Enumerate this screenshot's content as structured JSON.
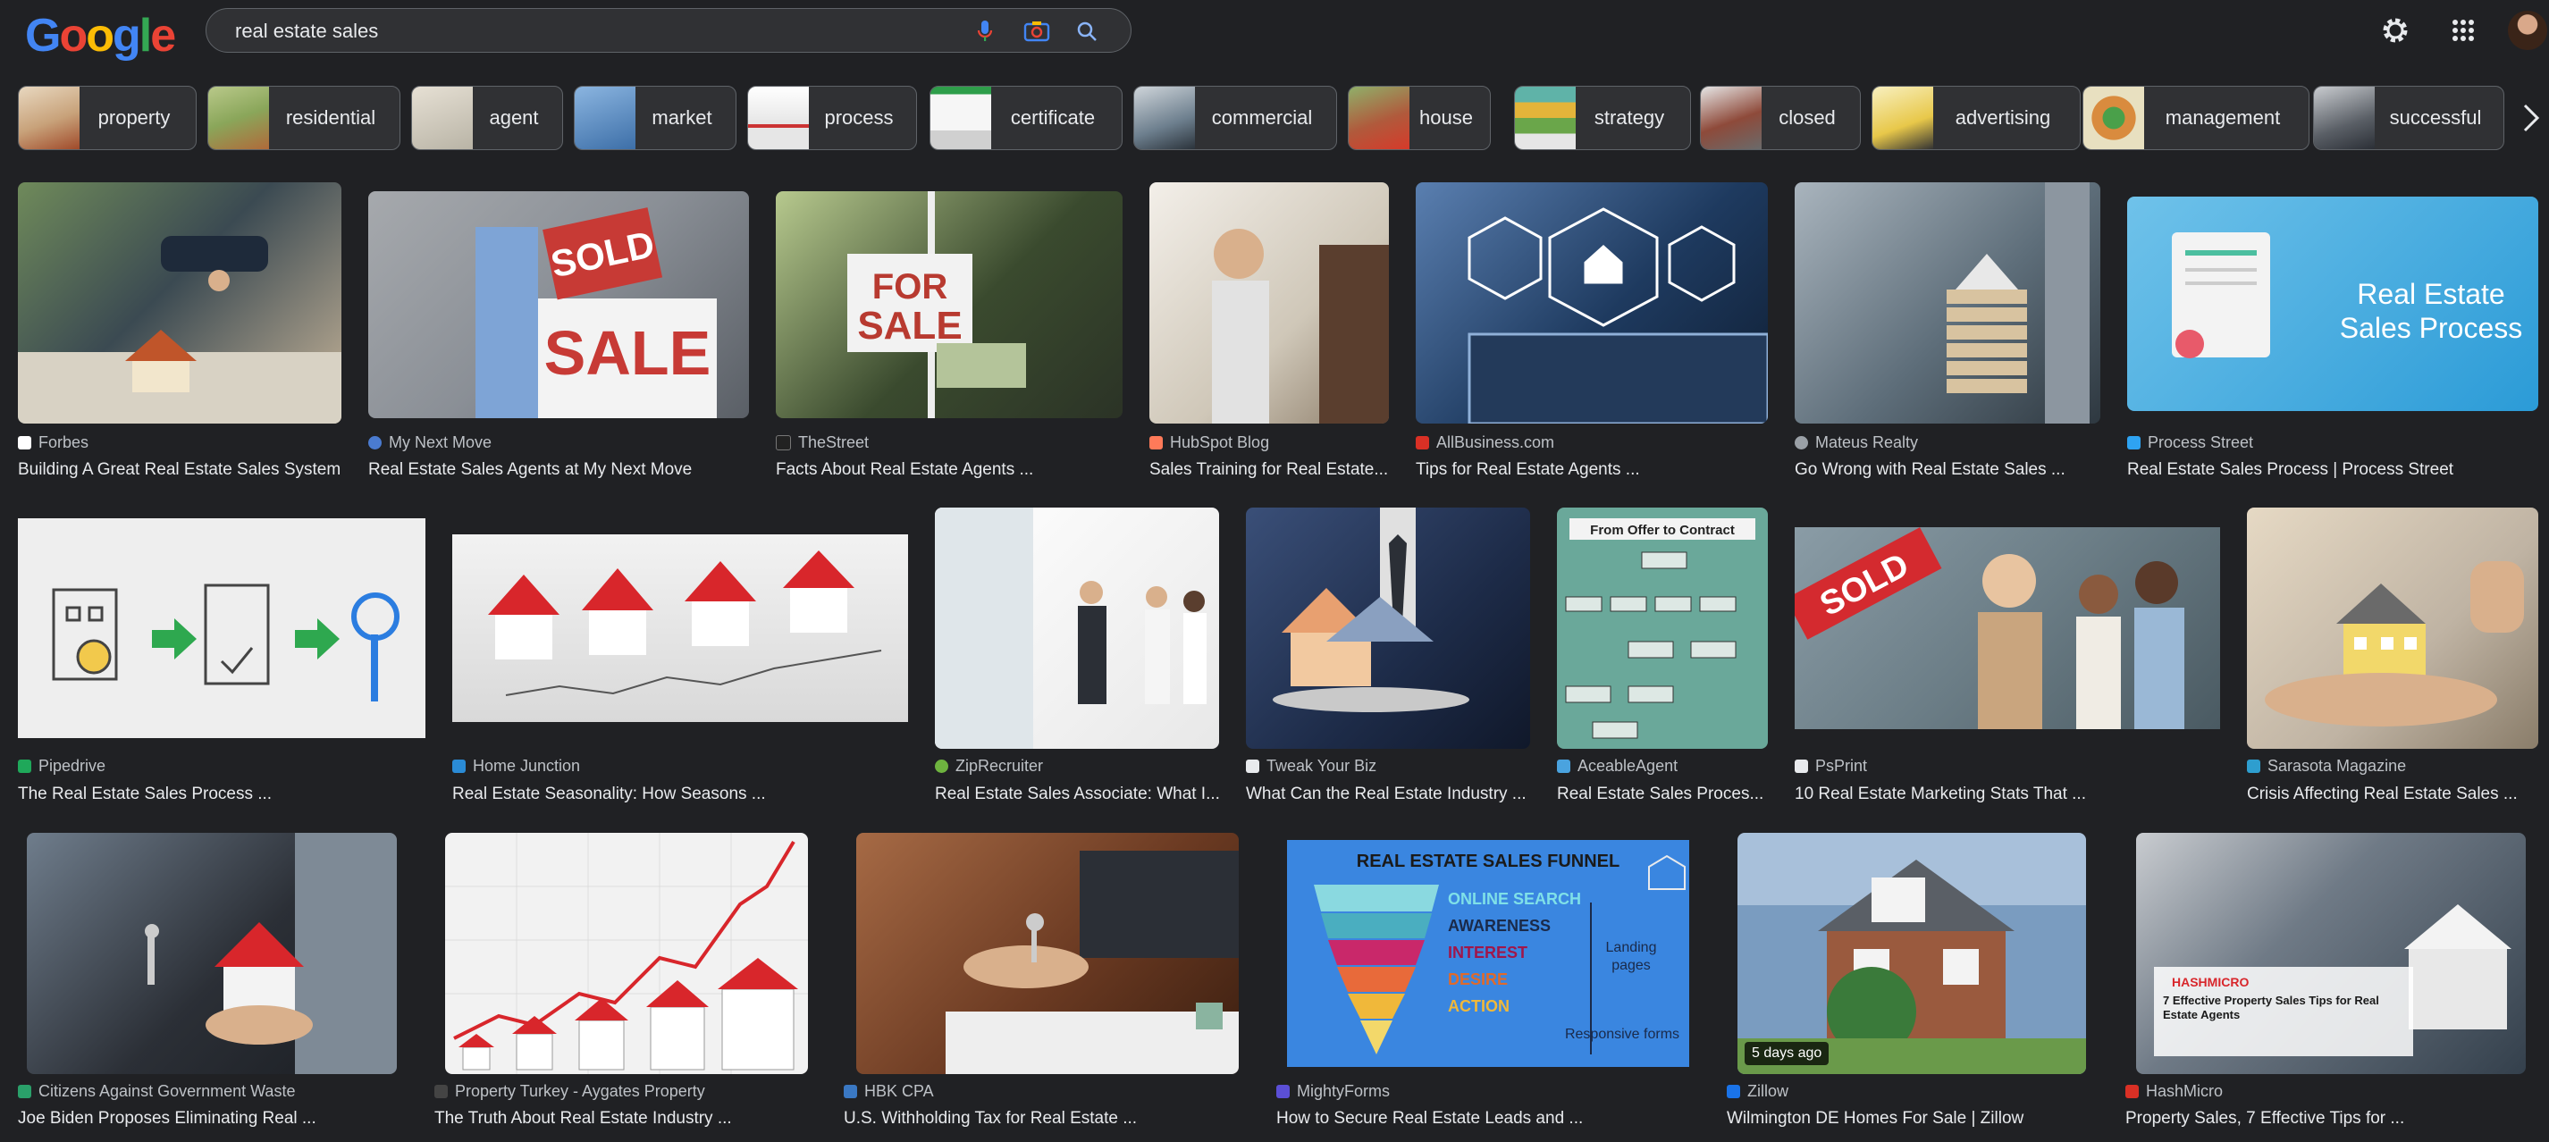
{
  "search": {
    "query": "real estate sales"
  },
  "logo": "Google",
  "chips": [
    {
      "label": "property",
      "color": "#c8a27a"
    },
    {
      "label": "residential",
      "color": "#8aa65a"
    },
    {
      "label": "agent",
      "color": "#b9b4a6"
    },
    {
      "label": "market",
      "color": "#3d6fa8"
    },
    {
      "label": "process",
      "color": "#e6e6e6"
    },
    {
      "label": "certificate",
      "color": "#f0f0f0"
    },
    {
      "label": "commercial",
      "color": "#6d7f8e"
    },
    {
      "label": "house",
      "color": "#b05a3c"
    },
    {
      "label": "strategy",
      "color": "#e3b43a"
    },
    {
      "label": "closed",
      "color": "#8e4a3a"
    },
    {
      "label": "advertising",
      "color": "#e8c84a"
    },
    {
      "label": "management",
      "color": "#d98b3e"
    },
    {
      "label": "successful",
      "color": "#5a5f66"
    }
  ],
  "results": [
    {
      "source": "Forbes",
      "title": "Building A Great Real Estate Sales System",
      "fav": "#ffffff",
      "c1": "#3b4a52",
      "c2": "#c9b69a"
    },
    {
      "source": "My Next Move",
      "title": "Real Estate Sales Agents at My Next Move",
      "fav": "#4a7bd0",
      "c1": "#8a8f96",
      "c2": "#c73a35",
      "text1": "SOLD",
      "text2": "SALE"
    },
    {
      "source": "TheStreet",
      "title": "Facts About Real Estate Agents ...",
      "fav": "#222222",
      "c1": "#3a4a2e",
      "c2": "#b83a30",
      "text1": "FOR",
      "text2": "SALE"
    },
    {
      "source": "HubSpot Blog",
      "title": "Sales Training for Real Estate...",
      "fav": "#ff7a59",
      "c1": "#cfc7b8",
      "c2": "#f3efe9"
    },
    {
      "source": "AllBusiness.com",
      "title": "Tips for Real Estate Agents ...",
      "fav": "#d93025",
      "c1": "#1e3a5f",
      "c2": "#5a7fb0"
    },
    {
      "source": "Mateus Realty",
      "title": "Go Wrong with Real Estate Sales ...",
      "fav": "#9aa0a6",
      "c1": "#5e6e7a",
      "c2": "#d8c3a0"
    },
    {
      "source": "Process Street",
      "title": "Real Estate Sales Process | Process Street",
      "fav": "#2ea3f2",
      "c1": "#2b9bd7",
      "c2": "#6fc2ea",
      "text1": "Real Estate",
      "text2": "Sales Process"
    },
    {
      "source": "Pipedrive",
      "title": "The Real Estate Sales Process ...",
      "fav": "#1fa85a",
      "c1": "#eeeeee",
      "c2": "#f5f5f5"
    },
    {
      "source": "Home Junction",
      "title": "Real Estate Seasonality: How Seasons ...",
      "fav": "#2a8bd6",
      "c1": "#d9d9d9",
      "c2": "#f2f2f2"
    },
    {
      "source": "ZipRecruiter",
      "title": "Real Estate Sales Associate: What I...",
      "fav": "#6eb33f",
      "c1": "#e8e8e8",
      "c2": "#ffffff"
    },
    {
      "source": "Tweak Your Biz",
      "title": "What Can the Real Estate Industry ...",
      "fav": "#e8eaed",
      "c1": "#1d2b48",
      "c2": "#3a4f78"
    },
    {
      "source": "AceableAgent",
      "title": "Real Estate Sales Proces...",
      "fav": "#4aa3df",
      "c1": "#6aa89a",
      "c2": "#7fbcae",
      "text1": "From Offer to Contract"
    },
    {
      "source": "PsPrint",
      "title": "10 Real Estate Marketing Stats That ...",
      "fav": "#e8eaed",
      "c1": "#6b7d86",
      "c2": "#c9a57e",
      "text1": "SOLD"
    },
    {
      "source": "Sarasota Magazine",
      "title": "Crisis Affecting Real Estate Sales ...",
      "fav": "#2e9ecf",
      "c1": "#bfb3a3",
      "c2": "#e6d9c4"
    },
    {
      "source": "Citizens Against Government Waste",
      "title": "Joe Biden Proposes Eliminating Real ...",
      "fav": "#2aa06a",
      "c1": "#2b2f36",
      "c2": "#6f7d8c"
    },
    {
      "source": "Property Turkey - Aygates Property",
      "title": "The Truth About Real Estate Industry ...",
      "fav": "#444444",
      "c1": "#f0f0f0",
      "c2": "#ffffff"
    },
    {
      "source": "HBK CPA",
      "title": "U.S. Withholding Tax for Real Estate ...",
      "fav": "#3a78c3",
      "c1": "#6b3a22",
      "c2": "#a66a45"
    },
    {
      "source": "MightyForms",
      "title": "How to Secure Real Estate Leads and ...",
      "fav": "#5b4fd6",
      "c1": "#3a86e0",
      "c2": "#5aa0ec",
      "text1": "REAL ESTATE SALES FUNNEL",
      "f1": "ONLINE SEARCH",
      "f2": "AWARENESS",
      "f3": "INTEREST",
      "f4": "DESIRE",
      "f5": "ACTION",
      "n1": "Landing",
      "n2": "pages",
      "n3": "Responsive forms"
    },
    {
      "source": "Zillow",
      "title": "Wilmington DE Homes For Sale | Zillow",
      "fav": "#1a73e8",
      "c1": "#7a9cc0",
      "c2": "#9a5a3e",
      "badge": "5 days ago"
    },
    {
      "source": "HashMicro",
      "title": "Property Sales, 7 Effective Tips for ...",
      "fav": "#d93025",
      "c1": "#34404c",
      "c2": "#c9ccd0",
      "text1": "HASHMICRO",
      "text2": "7 Effective Property Sales Tips for Real Estate Agents"
    }
  ]
}
